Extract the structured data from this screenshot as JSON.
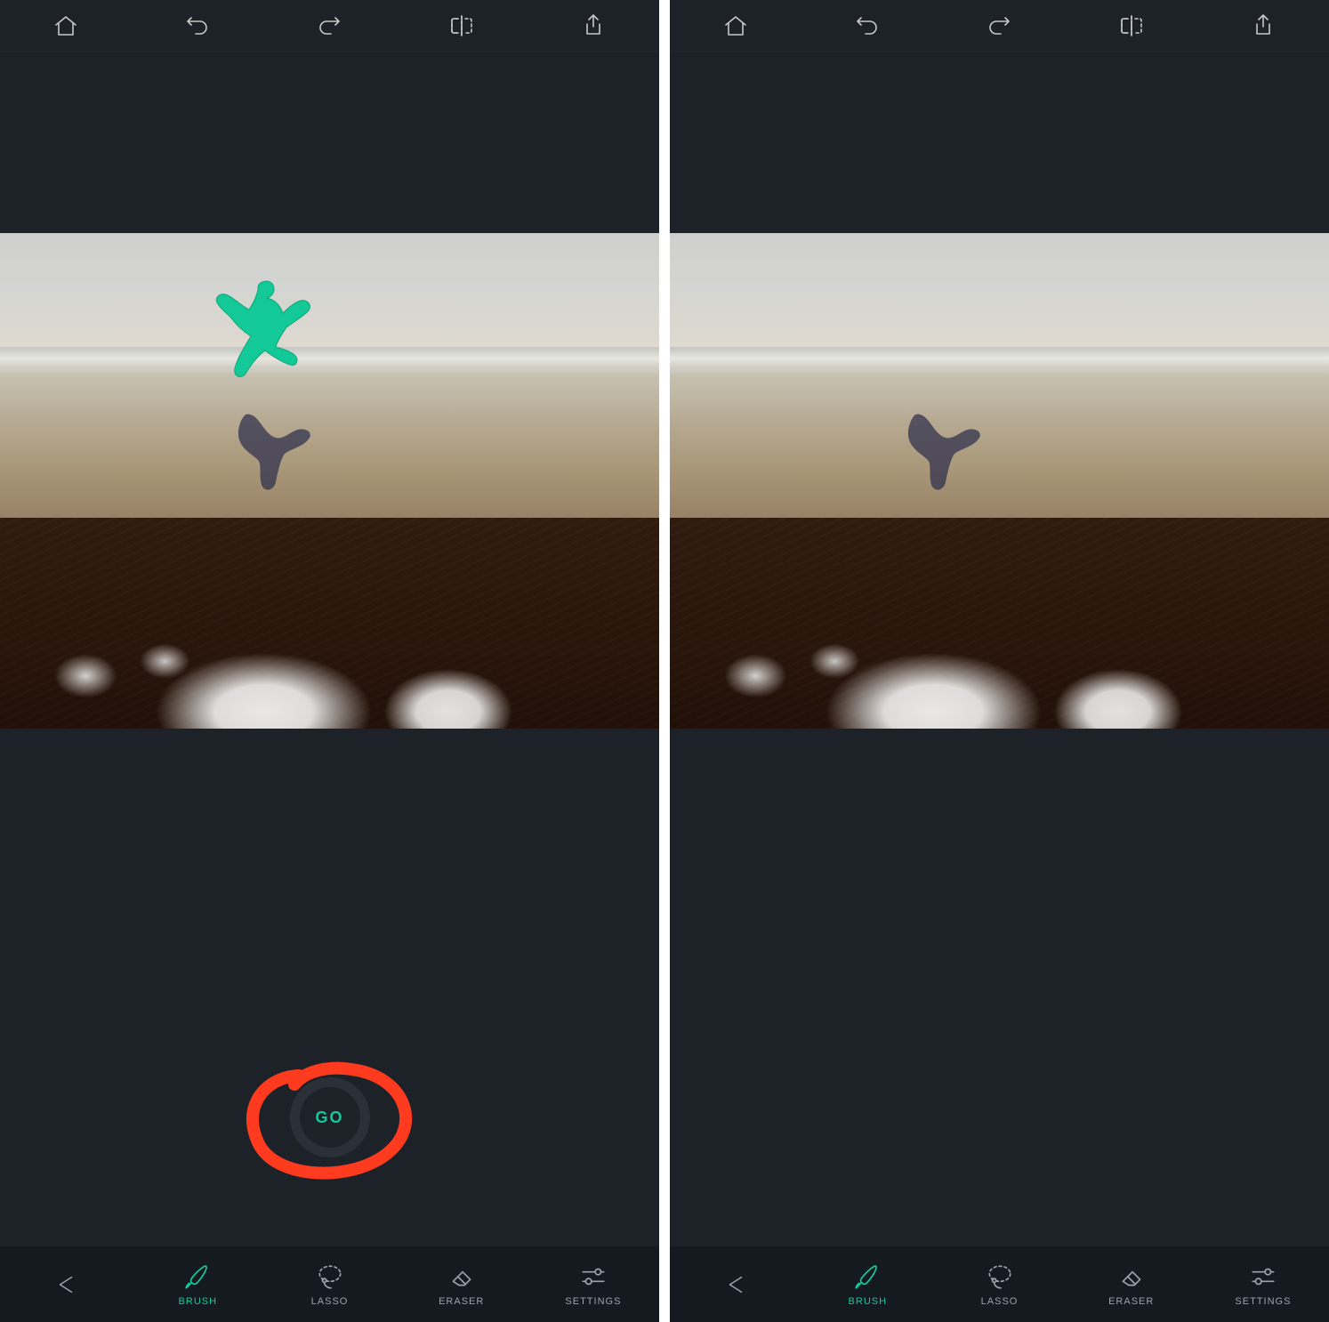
{
  "colors": {
    "accent": "#14c998",
    "annotation": "#ff3b1f"
  },
  "left": {
    "top_icons": [
      "home-icon",
      "undo-icon",
      "redo-icon",
      "compare-icon",
      "share-icon"
    ],
    "go_label": "GO",
    "go_annotated": true,
    "highlight_overlay": true,
    "bottom": {
      "back_icon": "back-arrow-icon",
      "tools": [
        {
          "id": "brush",
          "label": "BRUSH",
          "icon": "brush-icon",
          "active": true
        },
        {
          "id": "lasso",
          "label": "LASSO",
          "icon": "lasso-icon",
          "active": false
        },
        {
          "id": "eraser",
          "label": "ERASER",
          "icon": "eraser-icon",
          "active": false
        },
        {
          "id": "settings",
          "label": "SETTINGS",
          "icon": "settings-icon",
          "active": false
        }
      ]
    }
  },
  "right": {
    "top_icons": [
      "home-icon",
      "undo-icon",
      "redo-icon",
      "compare-icon",
      "share-icon"
    ],
    "go_visible": false,
    "highlight_overlay": false,
    "bottom": {
      "back_icon": "back-arrow-icon",
      "tools": [
        {
          "id": "brush",
          "label": "BRUSH",
          "icon": "brush-icon",
          "active": true
        },
        {
          "id": "lasso",
          "label": "LASSO",
          "icon": "lasso-icon",
          "active": false
        },
        {
          "id": "eraser",
          "label": "ERASER",
          "icon": "eraser-icon",
          "active": false
        },
        {
          "id": "settings",
          "label": "SETTINGS",
          "icon": "settings-icon",
          "active": false
        }
      ]
    }
  }
}
